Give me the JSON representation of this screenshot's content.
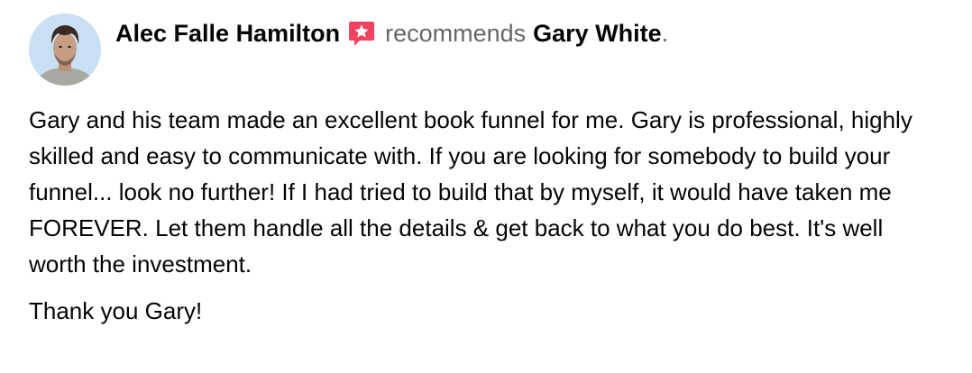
{
  "post": {
    "author": "Alec Falle Hamilton",
    "verb": "recommends",
    "target": "Gary White",
    "period": ".",
    "icon": "recommendation-icon",
    "accent_color": "#f3425f",
    "paragraphs": [
      "Gary and his team made an excellent book funnel for me.  Gary is professional, highly skilled and easy to communicate with.  If you are looking for somebody to build your funnel... look no further!  If I had tried to build that by myself, it would have taken me FOREVER.  Let them handle all the details & get back to what you do best.  It's well worth the investment.",
      "Thank you Gary!"
    ]
  }
}
